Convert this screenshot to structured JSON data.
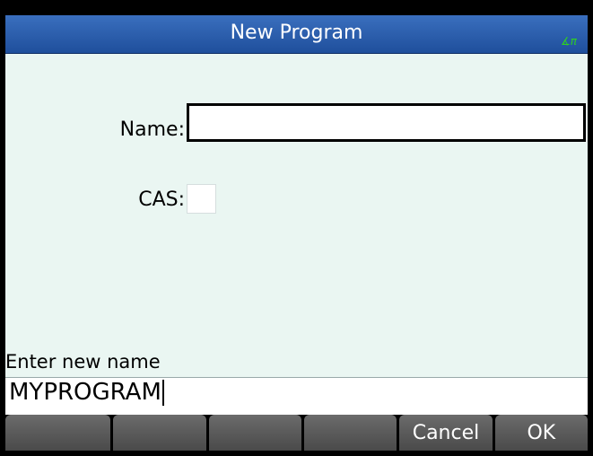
{
  "title_bar": {
    "title": "New Program",
    "angle_indicator": "∡π"
  },
  "form": {
    "name_label": "Name:",
    "name_value": "",
    "cas_label": "CAS:",
    "cas_checked": false
  },
  "prompt": {
    "text": "Enter new name"
  },
  "entry": {
    "value": "MYPROGRAM"
  },
  "softkeys": [
    "",
    "",
    "",
    "",
    "Cancel",
    "OK"
  ]
}
